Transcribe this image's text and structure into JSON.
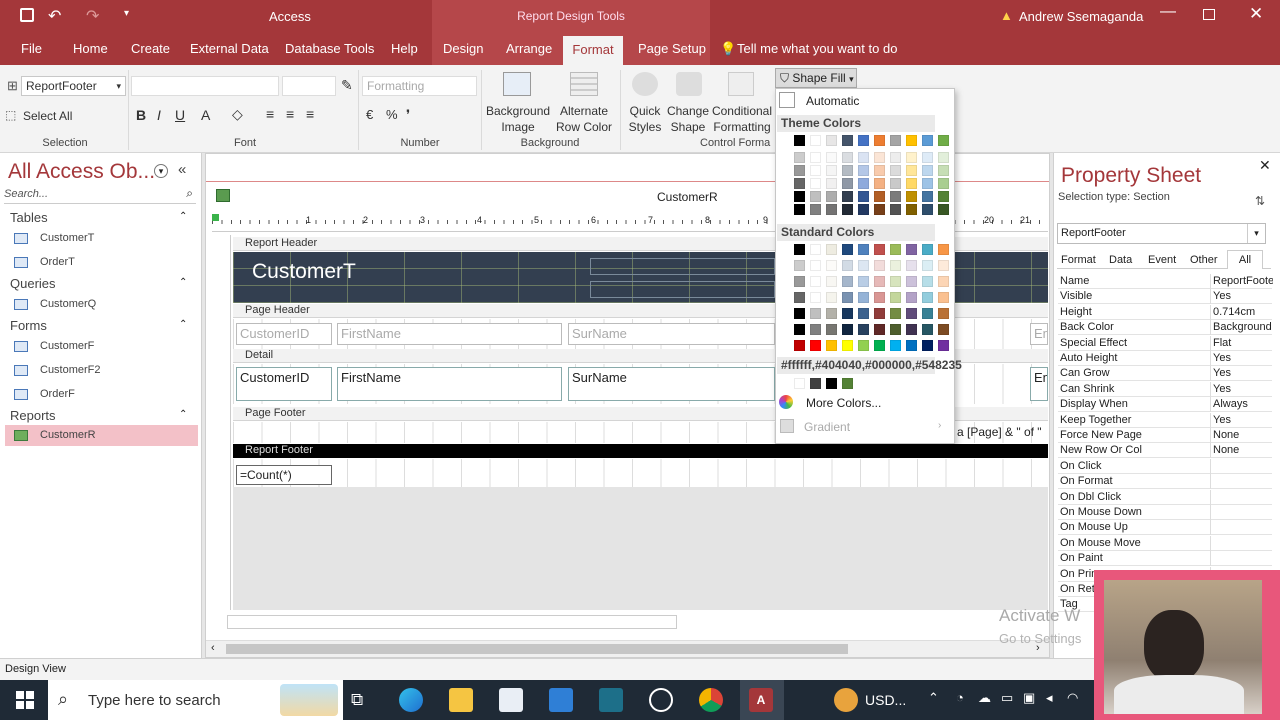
{
  "app": {
    "title": "Access",
    "context_title": "Report Design Tools",
    "user": "Andrew Ssemaganda"
  },
  "menu": {
    "items": [
      "File",
      "Home",
      "Create",
      "External Data",
      "Database Tools",
      "Help",
      "Design",
      "Arrange",
      "Format",
      "Page Setup"
    ],
    "tell_me": "Tell me what you want to do"
  },
  "ribbon": {
    "selection": {
      "object": "ReportFooter",
      "select_all": "Select All",
      "group": "Selection"
    },
    "font": {
      "group": "Font"
    },
    "number": {
      "format": "Formatting",
      "group": "Number"
    },
    "background": {
      "image_line1": "Background",
      "image_line2": "Image",
      "alt1": "Alternate",
      "alt2": "Row Color",
      "group": "Background"
    },
    "control_formatting": {
      "quick1": "Quick",
      "quick2": "Styles",
      "change1": "Change",
      "change2": "Shape",
      "cond1": "Conditional",
      "cond2": "Formatting",
      "group": "Control Forma",
      "shape_fill": "Shape Fill"
    }
  },
  "nav": {
    "title": "All Access Ob...",
    "search_placeholder": "Search...",
    "sections": [
      {
        "name": "Tables",
        "items": [
          "CustomerT",
          "OrderT"
        ]
      },
      {
        "name": "Queries",
        "items": [
          "CustomerQ"
        ]
      },
      {
        "name": "Forms",
        "items": [
          "CustomerF",
          "CustomerF2",
          "OrderF"
        ]
      },
      {
        "name": "Reports",
        "items": [
          "CustomerR"
        ]
      }
    ]
  },
  "report": {
    "tab": "CustomerR",
    "title": "CustomerT",
    "bands": {
      "report_header": "Report Header",
      "page_header": "Page Header",
      "detail": "Detail",
      "page_footer": "Page Footer",
      "report_footer": "Report Footer"
    },
    "header_fields": [
      "CustomerID",
      "FirstName",
      "SurName",
      "Em"
    ],
    "detail_fields": [
      "CustomerID",
      "FirstName",
      "SurName",
      "Em"
    ],
    "page_footer_expr": "a [Page] & \" of \"",
    "footer_expr": "=Count(*)",
    "ruler": [
      "1",
      "2",
      "3",
      "4",
      "5",
      "6",
      "7",
      "8",
      "9",
      "20",
      "21"
    ]
  },
  "shape_fill": {
    "automatic": "Automatic",
    "theme": "Theme Colors",
    "standard": "Standard Colors",
    "recent": [
      "#ffffff",
      "#404040",
      "#000000",
      "#548235"
    ],
    "more": "More Colors...",
    "gradient": "Gradient",
    "theme_top": [
      "#000000",
      "#ffffff",
      "#e7e6e6",
      "#44546a",
      "#4472c4",
      "#ed7d31",
      "#a5a5a5",
      "#ffc000",
      "#5b9bd5",
      "#70ad47"
    ],
    "standard_top": [
      "#000000",
      "#ffffff",
      "#eeece1",
      "#1f497d",
      "#4f81bd",
      "#c0504d",
      "#9bbb59",
      "#8064a2",
      "#4bacc6",
      "#f79646"
    ],
    "standard_bottom": [
      "#c00000",
      "#ff0000",
      "#ffc000",
      "#ffff00",
      "#92d050",
      "#00b050",
      "#00b0f0",
      "#0070c0",
      "#002060",
      "#7030a0"
    ]
  },
  "property_sheet": {
    "title": "Property Sheet",
    "selection_type": "Selection type:  Section",
    "object": "ReportFooter",
    "tabs": [
      "Format",
      "Data",
      "Event",
      "Other",
      "All"
    ],
    "rows": [
      [
        "Name",
        "ReportFoote"
      ],
      [
        "Visible",
        "Yes"
      ],
      [
        "Height",
        "0.714cm"
      ],
      [
        "Back Color",
        "Background"
      ],
      [
        "Special Effect",
        "Flat"
      ],
      [
        "Auto Height",
        "Yes"
      ],
      [
        "Can Grow",
        "Yes"
      ],
      [
        "Can Shrink",
        "Yes"
      ],
      [
        "Display When",
        "Always"
      ],
      [
        "Keep Together",
        "Yes"
      ],
      [
        "Force New Page",
        "None"
      ],
      [
        "New Row Or Col",
        "None"
      ],
      [
        "On Click",
        ""
      ],
      [
        "On Format",
        ""
      ],
      [
        "On Dbl Click",
        ""
      ],
      [
        "On Mouse Down",
        ""
      ],
      [
        "On Mouse Up",
        ""
      ],
      [
        "On Mouse Move",
        ""
      ],
      [
        "On Paint",
        ""
      ],
      [
        "On Prin",
        ""
      ],
      [
        "On Ret",
        ""
      ],
      [
        "Tag",
        ""
      ]
    ]
  },
  "status": {
    "left": "Design View"
  },
  "watermark": {
    "line1": "Activate W",
    "line2": "Go to Settings"
  },
  "taskbar": {
    "search": "Type here to search",
    "ticker": "USD..."
  }
}
